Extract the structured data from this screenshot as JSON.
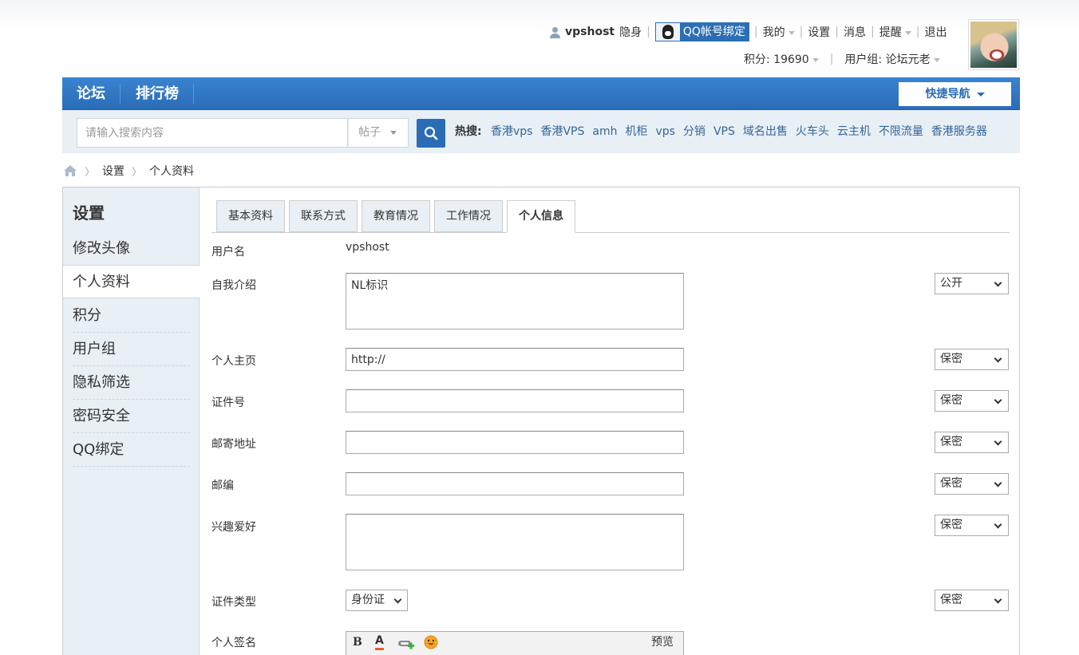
{
  "topbar": {
    "username": "vpshost",
    "status": "隐身",
    "qq_bind": "QQ帐号绑定",
    "my": "我的",
    "settings": "设置",
    "messages": "消息",
    "reminders": "提醒",
    "logout": "退出",
    "points": "积分: 19690",
    "usergroup": "用户组: 论坛元老"
  },
  "nav": {
    "items": [
      "论坛",
      "排行榜"
    ],
    "quick_nav": "快捷导航"
  },
  "search": {
    "placeholder": "请输入搜索内容",
    "type": "帖子",
    "hot_label": "热搜:",
    "hot": [
      "香港vps",
      "香港VPS",
      "amh",
      "机柜",
      "vps",
      "分销",
      "VPS",
      "域名出售",
      "火车头",
      "云主机",
      "不限流量",
      "香港服务器"
    ]
  },
  "breadcrumb": [
    "设置",
    "个人资料"
  ],
  "sidebar": {
    "title": "设置",
    "items": [
      "修改头像",
      "个人资料",
      "积分",
      "用户组",
      "隐私筛选",
      "密码安全",
      "QQ绑定"
    ]
  },
  "tabs": [
    "基本资料",
    "联系方式",
    "教育情况",
    "工作情况",
    "个人信息"
  ],
  "form": {
    "username_label": "用户名",
    "username_value": "vpshost",
    "bio_label": "自我介绍",
    "bio_value": "NL标识",
    "bio_privacy": "公开",
    "homepage_label": "个人主页",
    "homepage_value": "http://",
    "homepage_privacy": "保密",
    "idnumber_label": "证件号",
    "idnumber_privacy": "保密",
    "address_label": "邮寄地址",
    "address_privacy": "保密",
    "zipcode_label": "邮编",
    "zipcode_privacy": "保密",
    "hobbies_label": "兴趣爱好",
    "hobbies_privacy": "保密",
    "idtype_label": "证件类型",
    "idtype_value": "身份证",
    "idtype_privacy": "保密",
    "signature_label": "个人签名",
    "editor_bold": "B",
    "editor_color": "A",
    "editor_preview": "预览"
  },
  "colors": {
    "nav_blue": "#2a6cb6",
    "panel_bg": "#e8eff5",
    "link": "#336699"
  }
}
